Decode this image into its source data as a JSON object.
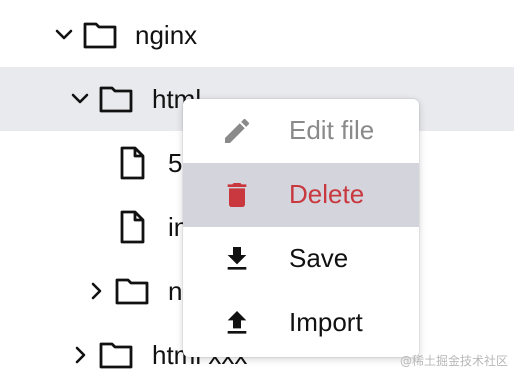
{
  "tree": {
    "items": [
      {
        "label": "nginx",
        "expanded": true
      },
      {
        "label": "html",
        "expanded": true,
        "selected": true
      },
      {
        "label": "5"
      },
      {
        "label": "in"
      },
      {
        "label": "n",
        "expanded": false
      },
      {
        "label": "html xxx",
        "expanded": false
      }
    ]
  },
  "context_menu": {
    "items": [
      {
        "label": "Edit file",
        "icon": "pencil-icon",
        "state": "disabled"
      },
      {
        "label": "Delete",
        "icon": "trash-icon",
        "state": "hover-danger"
      },
      {
        "label": "Save",
        "icon": "download-icon"
      },
      {
        "label": "Import",
        "icon": "upload-icon"
      }
    ]
  },
  "watermark": "@稀土掘金技术社区",
  "colors": {
    "selected_row": "#e9eaee",
    "menu_hover": "#d3d4dc",
    "danger": "#c8383e",
    "disabled": "#8a8a8a"
  }
}
